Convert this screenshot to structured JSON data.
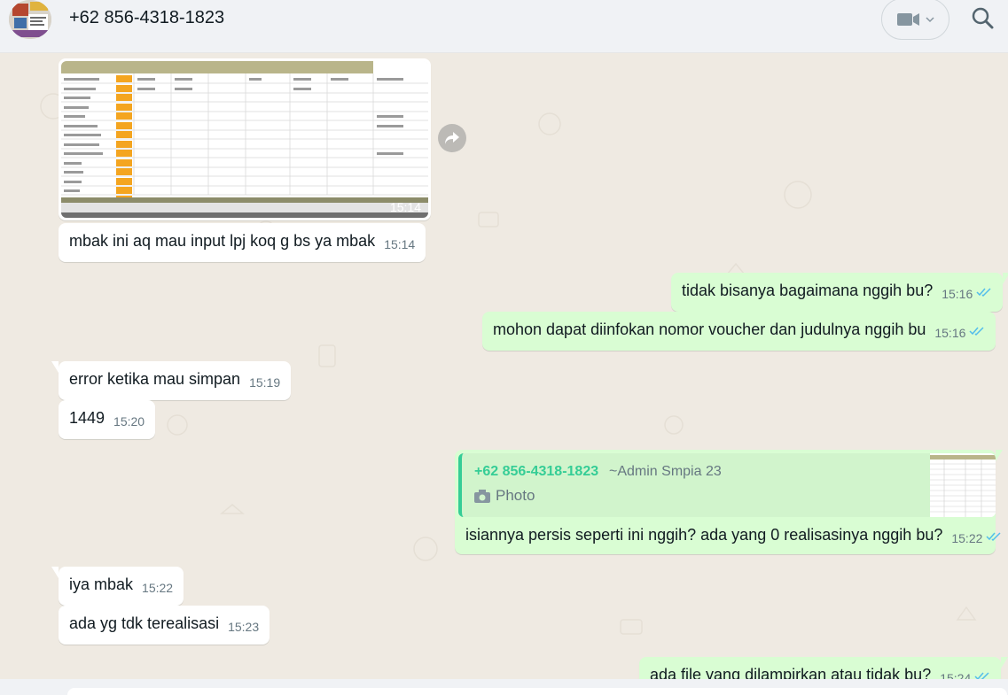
{
  "header": {
    "contact": "+62 856-4318-1823",
    "avatar_icon": "contact-avatar",
    "video_icon": "video-camera-icon",
    "search_icon": "search-icon"
  },
  "messages": {
    "m1": {
      "type": "image",
      "time": "15:14"
    },
    "m2": {
      "text": "mbak ini aq mau input lpj koq g bs ya mbak",
      "time": "15:14"
    },
    "m3": {
      "text": "tidak bisanya bagaimana nggih bu?",
      "time": "15:16"
    },
    "m4": {
      "text": "mohon dapat diinfokan nomor voucher dan judulnya nggih bu",
      "time": "15:16"
    },
    "m5": {
      "text": "error ketika mau simpan",
      "time": "15:19"
    },
    "m6": {
      "text": "1449",
      "time": "15:20"
    },
    "m7": {
      "quote_name": "+62 856-4318-1823",
      "quote_admin": "~Admin Smpia 23",
      "quote_label": "Photo",
      "text": "isiannya persis seperti ini nggih? ada yang 0 realisasinya nggih bu?",
      "time": "15:22"
    },
    "m8": {
      "text": "iya mbak",
      "time": "15:22"
    },
    "m9": {
      "text": "ada yg tdk terealisasi",
      "time": "15:23"
    },
    "m10": {
      "text": "ada file yang dilampirkan atau tidak bu?",
      "time": "15:24"
    }
  },
  "colors": {
    "chat_bg": "#efeae2",
    "incoming": "#ffffff",
    "outgoing": "#d9fdd3",
    "tick_read": "#53bdeb",
    "accent": "#35cd96"
  }
}
